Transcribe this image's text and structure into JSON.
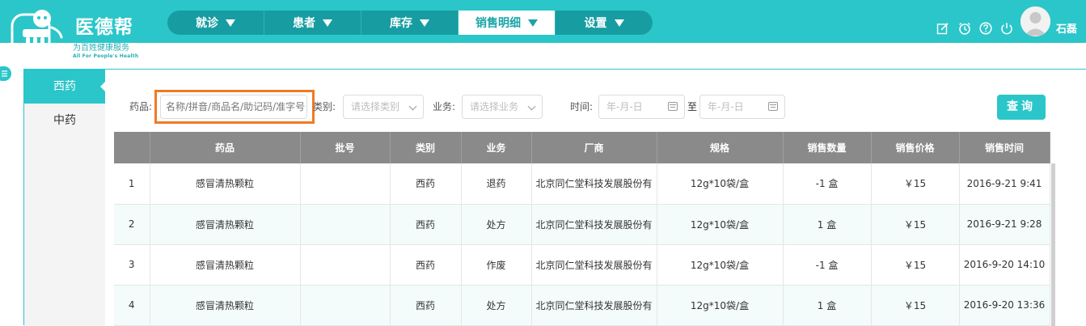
{
  "app": {
    "brand": "医德帮",
    "tagline": "为百姓健康服务",
    "tagline_en": "All For People's Health"
  },
  "nav": [
    {
      "label": "就诊",
      "active": false
    },
    {
      "label": "患者",
      "active": false
    },
    {
      "label": "库存",
      "active": false
    },
    {
      "label": "销售明细",
      "active": true
    },
    {
      "label": "设置",
      "active": false
    }
  ],
  "header_icons": [
    "edit-icon",
    "alarm-clock-icon",
    "help-icon",
    "power-icon"
  ],
  "user": {
    "name": "石磊"
  },
  "sidebar": {
    "items": [
      {
        "label": "西药",
        "active": true
      },
      {
        "label": "中药",
        "active": false
      }
    ]
  },
  "filters": {
    "drug_label": "药品:",
    "drug_placeholder": "名称/拼音/商品名/助记码/准字号",
    "category_label": "类别:",
    "category_placeholder": "请选择类别",
    "business_label": "业务:",
    "business_placeholder": "请选择业务",
    "time_label": "时间:",
    "date_from_placeholder": "年-月-日",
    "to_label": "至",
    "date_to_placeholder": "年-月-日",
    "query_button": "查询"
  },
  "table": {
    "columns": [
      "",
      "药品",
      "批号",
      "类别",
      "业务",
      "厂商",
      "规格",
      "销售数量",
      "销售价格",
      "销售时间"
    ],
    "rows": [
      {
        "no": "1",
        "drug": "感冒清热颗粒",
        "batch": "",
        "category": "西药",
        "business": "退药",
        "maker": "北京同仁堂科技发展股份有",
        "spec": "12g*10袋/盒",
        "qty": "-1 盒",
        "price": "￥15",
        "time": "2016-9-21 9:41"
      },
      {
        "no": "2",
        "drug": "感冒清热颗粒",
        "batch": "",
        "category": "西药",
        "business": "处方",
        "maker": "北京同仁堂科技发展股份有",
        "spec": "12g*10袋/盒",
        "qty": "1 盒",
        "price": "￥15",
        "time": "2016-9-21 9:28"
      },
      {
        "no": "3",
        "drug": "感冒清热颗粒",
        "batch": "",
        "category": "西药",
        "business": "作废",
        "maker": "北京同仁堂科技发展股份有",
        "spec": "12g*10袋/盒",
        "qty": "-1 盒",
        "price": "￥15",
        "time": "2016-9-20 14:10"
      },
      {
        "no": "4",
        "drug": "感冒清热颗粒",
        "batch": "",
        "category": "西药",
        "business": "处方",
        "maker": "北京同仁堂科技发展股份有",
        "spec": "12g*10袋/盒",
        "qty": "1 盒",
        "price": "￥15",
        "time": "2016-9-20 13:36"
      }
    ]
  },
  "colors": {
    "primary": "#2bc6c9",
    "nav_bg": "#179da1",
    "table_header": "#8a8a8a",
    "highlight": "#f07a24"
  }
}
